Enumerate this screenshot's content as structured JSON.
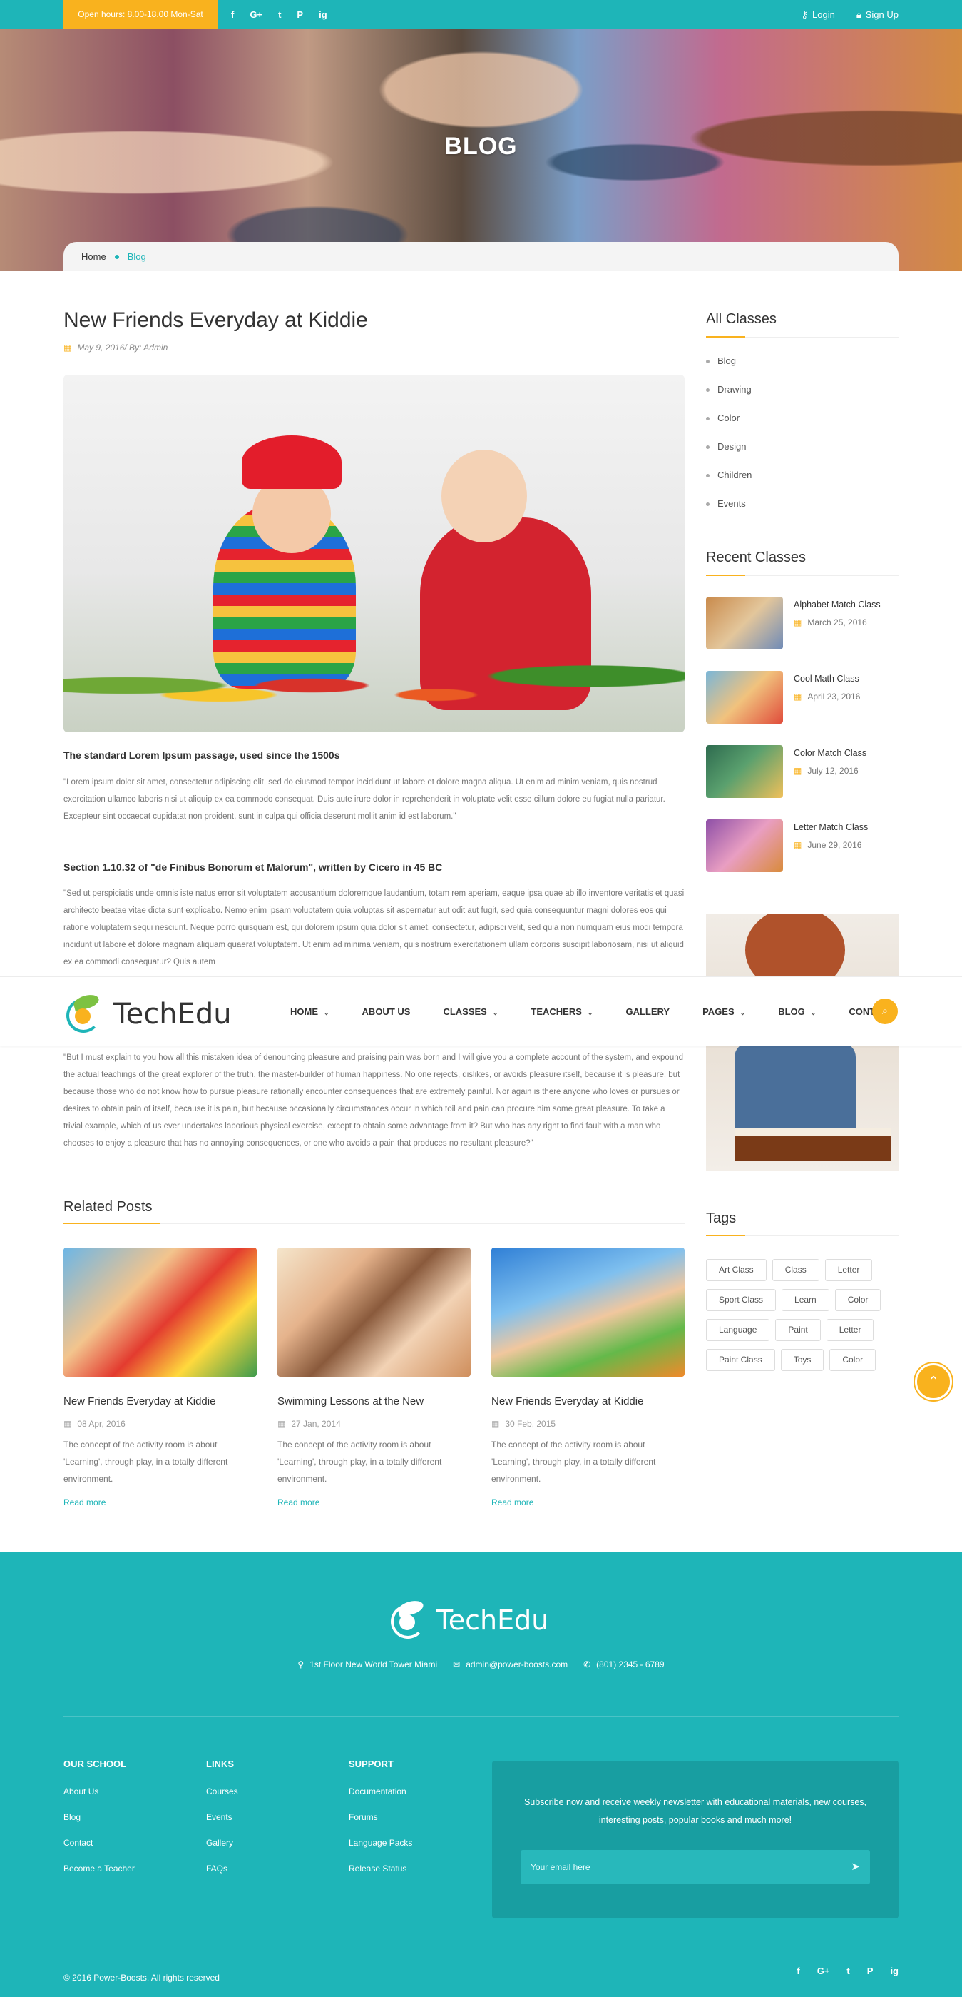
{
  "topbar": {
    "hours": "Open hours: 8.00-18.00 Mon-Sat",
    "social": [
      "f",
      "G+",
      "t",
      "P",
      "ig"
    ],
    "login": "Login",
    "signup": "Sign Up"
  },
  "hero": {
    "title": "BLOG"
  },
  "breadcrumb": {
    "home": "Home",
    "current": "Blog"
  },
  "post": {
    "title": "New Friends Everyday at Kiddie",
    "meta": "May 9, 2016/ By: Admin",
    "section1_title": "The standard Lorem Ipsum passage, used since the 1500s",
    "section1_text": "\"Lorem ipsum dolor sit amet, consectetur adipiscing elit, sed do eiusmod tempor incididunt ut labore et dolore magna aliqua. Ut enim ad minim veniam, quis nostrud exercitation ullamco laboris nisi ut aliquip ex ea commodo consequat. Duis aute irure dolor in reprehenderit in voluptate velit esse cillum dolore eu fugiat nulla pariatur. Excepteur sint occaecat cupidatat non proident, sunt in culpa qui officia deserunt mollit anim id est laborum.\"",
    "section2_title": "Section 1.10.32 of \"de Finibus Bonorum et Malorum\", written by Cicero in 45 BC",
    "section2_text": "\"Sed ut perspiciatis unde omnis iste natus error sit voluptatem accusantium doloremque laudantium, totam rem aperiam, eaque ipsa quae ab illo inventore veritatis et quasi architecto beatae vitae dicta sunt explicabo. Nemo enim ipsam voluptatem quia voluptas sit aspernatur aut odit aut fugit, sed quia consequuntur magni dolores eos qui ratione voluptatem sequi nesciunt. Neque porro quisquam est, qui dolorem ipsum quia dolor sit amet, consectetur, adipisci velit, sed quia non numquam eius modi tempora incidunt ut labore et dolore magnam aliquam quaerat voluptatem. Ut enim ad minima veniam, quis nostrum exercitationem ullam corporis suscipit laboriosam, nisi ut aliquid ex ea commodi consequatur? Quis autem",
    "section3_text": "\"But I must explain to you how all this mistaken idea of denouncing pleasure and praising pain was born and I will give you a complete account of the system, and expound the actual teachings of the great explorer of the truth, the master-builder of human happiness. No one rejects, dislikes, or avoids pleasure itself, because it is pleasure, but because those who do not know how to pursue pleasure rationally encounter consequences that are extremely painful. Nor again is there anyone who loves or pursues or desires to obtain pain of itself, because it is pain, but because occasionally circumstances occur in which toil and pain can procure him some great pleasure. To take a trivial example, which of us ever undertakes laborious physical exercise, except to obtain some advantage from it? But who has any right to find fault with a man who chooses to enjoy a pleasure that has no annoying consequences, or one who avoids a pain that produces no resultant pleasure?\""
  },
  "sidebar": {
    "all_classes_title": "All Classes",
    "categories": [
      "Blog",
      "Drawing",
      "Color",
      "Design",
      "Children",
      "Events"
    ],
    "recent_title": "Recent Classes",
    "recent": [
      {
        "title": "Alphabet Match Class",
        "date": "March 25, 2016"
      },
      {
        "title": "Cool Math Class",
        "date": "April 23, 2016"
      },
      {
        "title": "Color Match Class",
        "date": "July 12, 2016"
      },
      {
        "title": "Letter Match Class",
        "date": "June 29, 2016"
      }
    ],
    "tags_title": "Tags",
    "tags": [
      "Art Class",
      "Class",
      "Letter",
      "Sport Class",
      "Learn",
      "Color",
      "Language",
      "Paint",
      "Letter",
      "Paint Class",
      "Toys",
      "Color"
    ]
  },
  "nav": {
    "brand": "TechEdu",
    "items": [
      {
        "label": "HOME",
        "dropdown": true
      },
      {
        "label": "ABOUT US",
        "dropdown": false
      },
      {
        "label": "CLASSES",
        "dropdown": true
      },
      {
        "label": "TEACHERS",
        "dropdown": true
      },
      {
        "label": "GALLERY",
        "dropdown": false
      },
      {
        "label": "PAGES",
        "dropdown": true
      },
      {
        "label": "BLOG",
        "dropdown": true
      },
      {
        "label": "CONTACT",
        "dropdown": false
      }
    ]
  },
  "related": {
    "title": "Related Posts",
    "posts": [
      {
        "title": "New Friends Everyday at Kiddie",
        "date": "08 Apr, 2016",
        "desc": "The concept of the activity room is about 'Learning', through play, in a totally different environment.",
        "more": "Read more"
      },
      {
        "title": "Swimming Lessons at the New",
        "date": "27 Jan, 2014",
        "desc": "The concept of the activity room is about 'Learning', through play, in a totally different environment.",
        "more": "Read more"
      },
      {
        "title": "New Friends Everyday at Kiddie",
        "date": "30 Feb, 2015",
        "desc": "The concept of the activity room is about 'Learning', through play, in a totally different environment.",
        "more": "Read more"
      }
    ]
  },
  "footer": {
    "brand": "TechEdu",
    "address": "1st Floor New World Tower Miami",
    "email": "admin@power-boosts.com",
    "phone": "(801) 2345 - 6789",
    "col1": {
      "title": "OUR SCHOOL",
      "links": [
        "About Us",
        "Blog",
        "Contact",
        "Become a Teacher"
      ]
    },
    "col2": {
      "title": "LINKS",
      "links": [
        "Courses",
        "Events",
        "Gallery",
        "FAQs"
      ]
    },
    "col3": {
      "title": "SUPPORT",
      "links": [
        "Documentation",
        "Forums",
        "Language Packs",
        "Release Status"
      ]
    },
    "newsletter_text": "Subscribe now and receive weekly newsletter with educational materials, new courses, interesting posts, popular books and much more!",
    "email_placeholder": "Your email here",
    "copyright": "© 2016 Power-Boosts. All rights reserved",
    "social": [
      "f",
      "G+",
      "t",
      "P",
      "ig"
    ]
  },
  "colors": {
    "primary": "#1eb5b8",
    "accent": "#f9b21e"
  }
}
